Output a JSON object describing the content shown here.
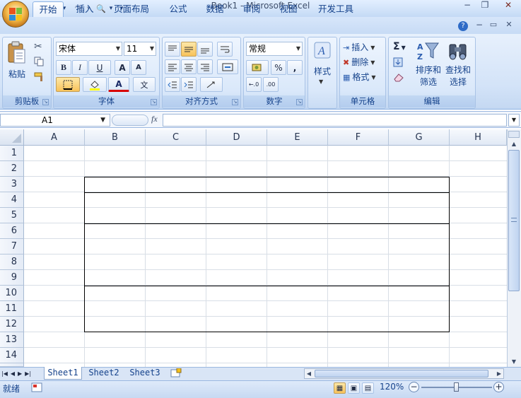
{
  "window": {
    "title": "Book1 - Microsoft Excel",
    "minimize": "−",
    "restore": "❐",
    "close": "✕"
  },
  "qat": {
    "save": "💾",
    "undo": "↶",
    "redo": "↷",
    "preview": "🔍",
    "more": "▾"
  },
  "tabs": [
    "开始",
    "插入",
    "页面布局",
    "公式",
    "数据",
    "审阅",
    "视图",
    "开发工具"
  ],
  "ribbon_controls": {
    "help": "?",
    "min": "−",
    "restore": "▭",
    "close": "✕"
  },
  "clipboard": {
    "paste_label": "粘贴",
    "group_label": "剪贴板"
  },
  "font": {
    "name": "宋体",
    "size": "11",
    "bold": "B",
    "italic": "I",
    "underline": "U",
    "grow": "A",
    "shrink": "A",
    "color": "A",
    "wen": "文",
    "group_label": "字体"
  },
  "alignment": {
    "group_label": "对齐方式"
  },
  "number": {
    "format": "常规",
    "percent": "%",
    "comma": ",",
    "inc": "←.0",
    "dec": ".00",
    "group_label": "数字"
  },
  "styles": {
    "label": "样式"
  },
  "cells": {
    "insert": "插入",
    "delete": "删除",
    "format": "格式",
    "group_label": "单元格"
  },
  "editing": {
    "sigma": "Σ",
    "sort_line1": "排序和",
    "sort_line2": "筛选",
    "find_line1": "查找和",
    "find_line2": "选择",
    "group_label": "编辑"
  },
  "formula_bar": {
    "name_box": "A1",
    "fx": "fx"
  },
  "columns": [
    "A",
    "B",
    "C",
    "D",
    "E",
    "F",
    "G",
    "H"
  ],
  "rows": [
    "1",
    "2",
    "3",
    "4",
    "5",
    "6",
    "7",
    "8",
    "9",
    "10",
    "11",
    "12",
    "13",
    "14"
  ],
  "sheets": [
    "Sheet1",
    "Sheet2",
    "Sheet3"
  ],
  "status": {
    "ready": "就绪",
    "zoom": "120%",
    "zoom_out": "−",
    "zoom_in": "+"
  },
  "colors": {
    "accent": "#15428b",
    "ribbon": "#dae8fa",
    "selection": "#f8c25a"
  }
}
